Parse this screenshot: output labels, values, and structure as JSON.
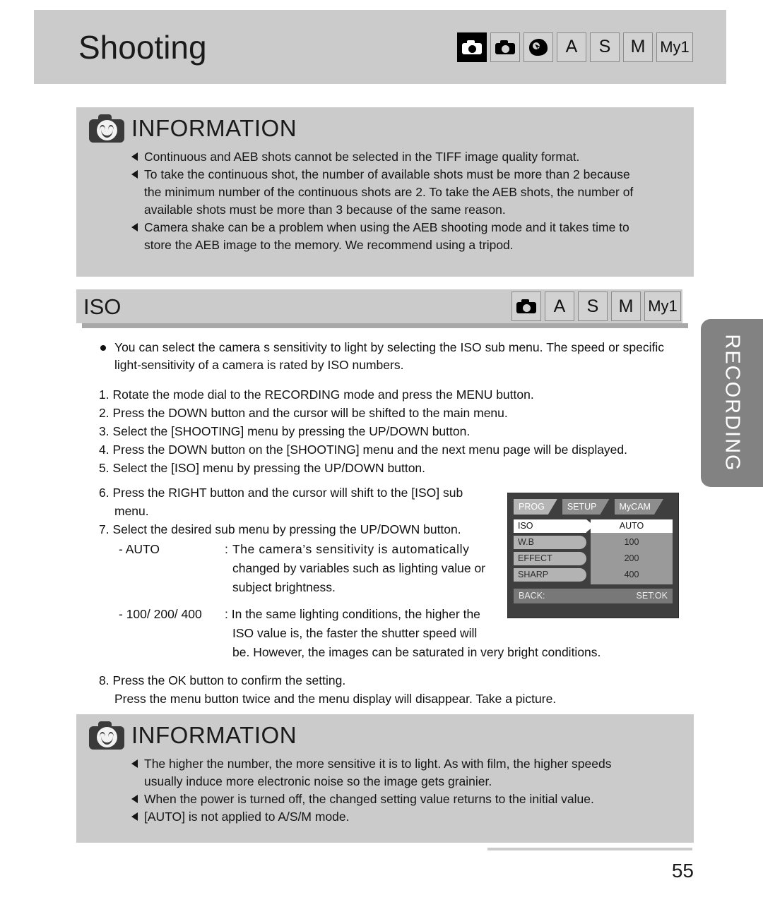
{
  "page": {
    "title": "Shooting",
    "number": "55",
    "side_tab": "RECORDING"
  },
  "title_modes": [
    {
      "name": "mode-auto-icon",
      "glyph": "camera-inverted",
      "label": ""
    },
    {
      "name": "mode-program-icon",
      "glyph": "camera",
      "label": ""
    },
    {
      "name": "mode-scene-icon",
      "glyph": "scene",
      "label": ""
    },
    {
      "name": "mode-aperture-icon",
      "glyph": "text",
      "label": "A"
    },
    {
      "name": "mode-shutter-icon",
      "glyph": "text",
      "label": "S"
    },
    {
      "name": "mode-manual-icon",
      "glyph": "text",
      "label": "M"
    },
    {
      "name": "mode-my1-icon",
      "glyph": "text",
      "label": "My1"
    }
  ],
  "info_top": {
    "heading": "INFORMATION",
    "items": [
      {
        "text": "Continuous and AEB shots cannot be selected in the TIFF image quality format.",
        "cont": []
      },
      {
        "text": "To take the continuous shot, the number of available shots must be more than 2 because",
        "cont": [
          "the minimum number of the continuous shots are 2. To take the AEB shots, the number of",
          "available shots must be more than 3 because of the same reason."
        ]
      },
      {
        "text": "Camera shake can be a problem when using the AEB shooting mode and it takes time to",
        "cont": [
          "store the AEB image to the memory. We recommend using a tripod."
        ]
      }
    ]
  },
  "iso_section": {
    "title": "ISO",
    "modes": [
      {
        "name": "mode-program-icon",
        "glyph": "camera",
        "label": ""
      },
      {
        "name": "mode-aperture-icon",
        "glyph": "text",
        "label": "A"
      },
      {
        "name": "mode-shutter-icon",
        "glyph": "text",
        "label": "S"
      },
      {
        "name": "mode-manual-icon",
        "glyph": "text",
        "label": "M"
      },
      {
        "name": "mode-my1-icon",
        "glyph": "text",
        "label": "My1"
      }
    ],
    "intro_line1": "You can select the camera s sensitivity to light by selecting the ISO sub menu. The speed or specific",
    "intro_line2": "light-sensitivity of a camera is rated by ISO numbers.",
    "steps": [
      "1. Rotate the mode dial to the RECORDING mode and press the MENU button.",
      "2. Press the DOWN button and the cursor will be shifted to the main menu.",
      "3. Select the [SHOOTING] menu by pressing the UP/DOWN button.",
      "4. Press the DOWN button on the [SHOOTING] menu and the next menu page will be displayed.",
      "5. Select the [ISO] menu by pressing the UP/DOWN button.",
      "6. Press the RIGHT button and the cursor will shift to the [ISO] sub menu.",
      "7. Select the desired sub menu by pressing the UP/DOWN button."
    ],
    "definitions": [
      {
        "term": "- AUTO",
        "lines": [
          "The camera’s sensitivity is automatically",
          "changed by variables such as lighting value or",
          "subject brightness."
        ]
      },
      {
        "term": "- 100/ 200/ 400",
        "lines": [
          "In the same lighting conditions, the higher the",
          "ISO value is, the faster the shutter speed will",
          "be. However, the images can be saturated in very bright conditions."
        ]
      }
    ],
    "step8": "8. Press the OK button to confirm the setting.",
    "step8_cont": "Press the menu button twice and the menu display will disappear. Take a picture."
  },
  "lcd_menu": {
    "tabs": [
      {
        "label": "PROG",
        "active": true
      },
      {
        "label": "SETUP",
        "active": false
      },
      {
        "label": "MyCAM",
        "active": false
      }
    ],
    "items": [
      {
        "label": "ISO",
        "selected": true
      },
      {
        "label": "W.B",
        "selected": false
      },
      {
        "label": "EFFECT",
        "selected": false
      },
      {
        "label": "SHARP",
        "selected": false
      }
    ],
    "options": [
      {
        "label": "AUTO",
        "selected": true
      },
      {
        "label": "100",
        "selected": false
      },
      {
        "label": "200",
        "selected": false
      },
      {
        "label": "400",
        "selected": false
      }
    ],
    "footer_left": "BACK:",
    "footer_right": "SET:OK"
  },
  "info_bottom": {
    "heading": "INFORMATION",
    "items": [
      {
        "text": "The higher the number, the more sensitive it is to light. As with film, the higher speeds",
        "cont": [
          "usually induce more electronic noise so the image gets grainier."
        ]
      },
      {
        "text": "When the power is turned off, the changed setting value returns to the initial value.",
        "cont": []
      },
      {
        "text": "[AUTO] is not applied to A/S/M mode.",
        "cont": []
      }
    ]
  },
  "colors": {
    "band_gray": "#cbcbcb",
    "mode_box_gray": "#d2d2d2",
    "side_tab_gray": "#828282",
    "lcd_bg": "#3f3f3f"
  }
}
